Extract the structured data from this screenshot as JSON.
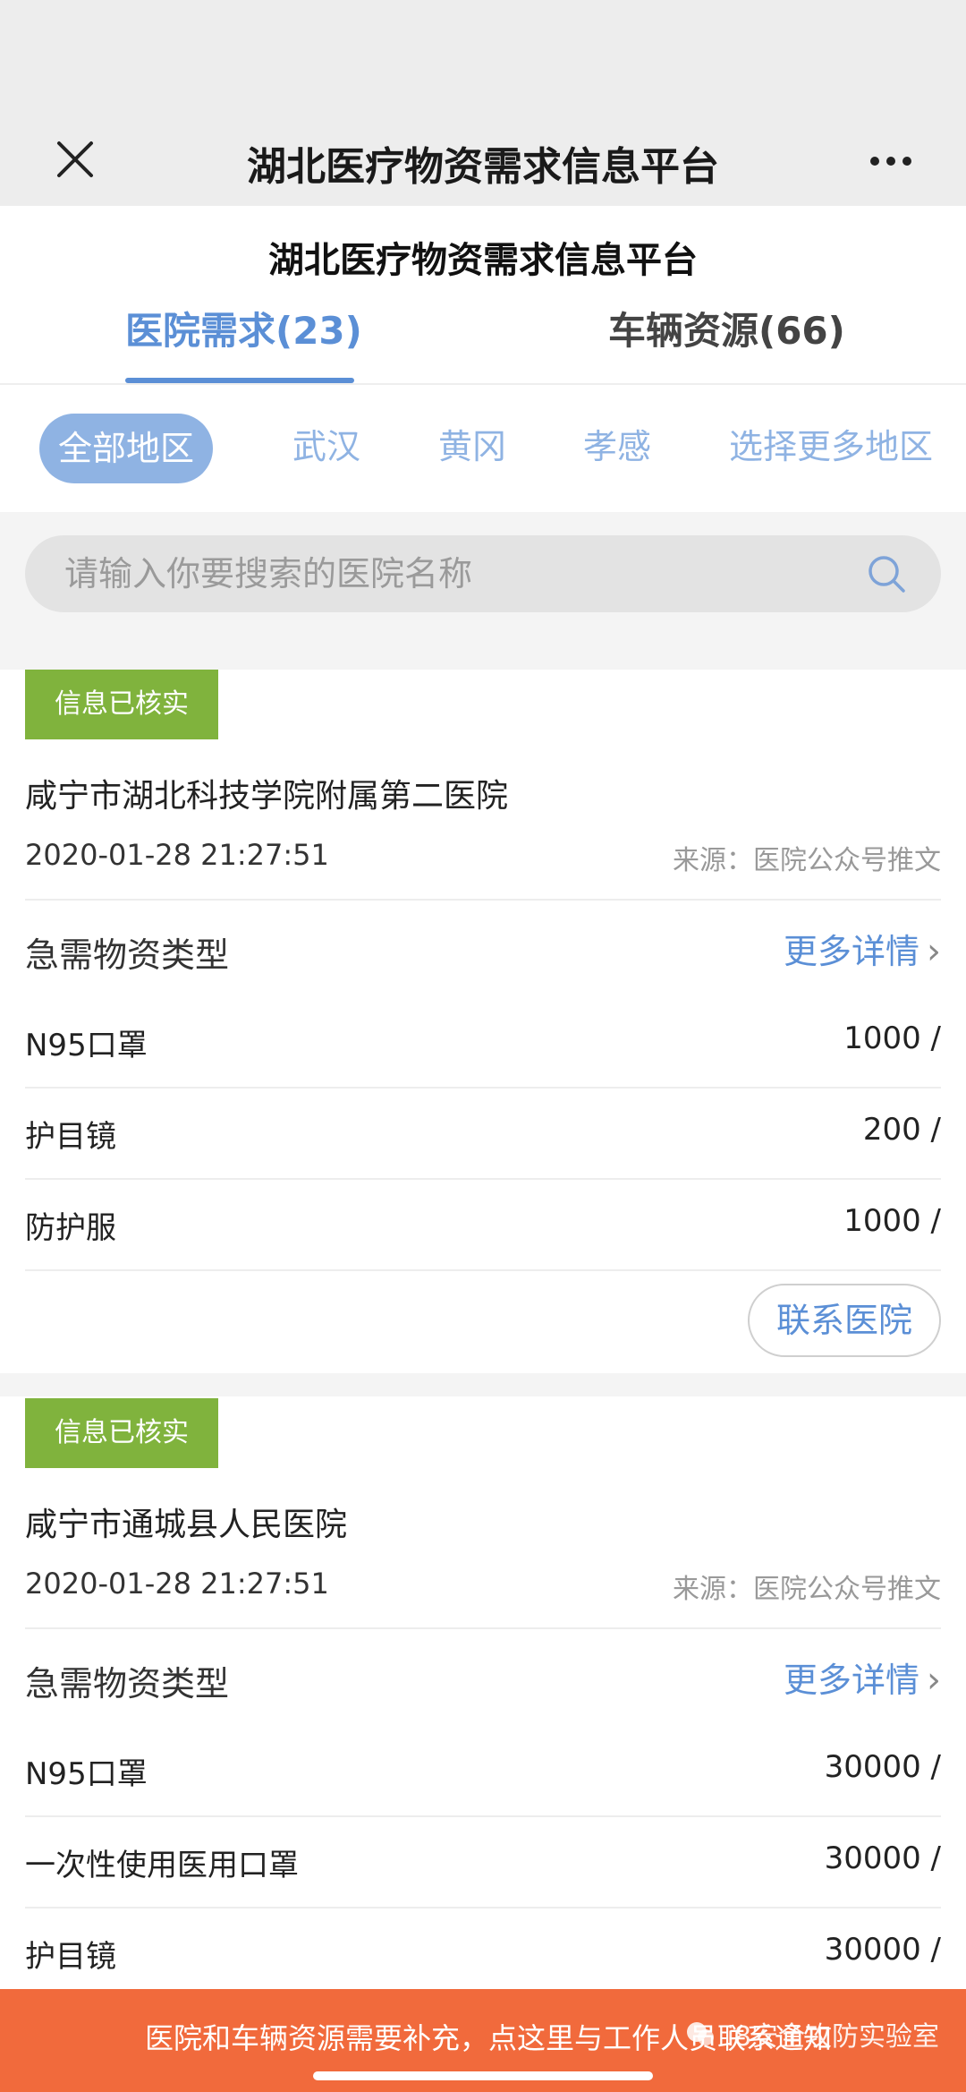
{
  "nav": {
    "title": "湖北医疗物资需求信息平台"
  },
  "page_title": "湖北医疗物资需求信息平台",
  "tabs": [
    {
      "label": "医院需求(23)",
      "active": true
    },
    {
      "label": "车辆资源(66)",
      "active": false
    }
  ],
  "regions": [
    {
      "label": "全部地区",
      "active": true
    },
    {
      "label": "武汉"
    },
    {
      "label": "黄冈"
    },
    {
      "label": "孝感"
    },
    {
      "label": "选择更多地区"
    }
  ],
  "search": {
    "placeholder": "请输入你要搜索的医院名称"
  },
  "cards": [
    {
      "badge": "信息已核实",
      "name": "咸宁市湖北科技学院附属第二医院",
      "date": "2020-01-28 21:27:51",
      "source": "来源：医院公众号推文",
      "type_label": "急需物资类型",
      "more_label": "更多详情",
      "items": [
        {
          "name": "N95口罩",
          "qty": "1000 /"
        },
        {
          "name": "护目镜",
          "qty": "200 /"
        },
        {
          "name": "防护服",
          "qty": "1000 /"
        }
      ],
      "contact_label": "联系医院"
    },
    {
      "badge": "信息已核实",
      "name": "咸宁市通城县人民医院",
      "date": "2020-01-28 21:27:51",
      "source": "来源：医院公众号推文",
      "type_label": "急需物资类型",
      "more_label": "更多详情",
      "items": [
        {
          "name": "N95口罩",
          "qty": "30000 /"
        },
        {
          "name": "一次性使用医用口罩",
          "qty": "30000 /"
        },
        {
          "name": "护目镜",
          "qty": "30000 /"
        }
      ]
    }
  ],
  "footer": {
    "text": "医院和车辆资源需要补充，点这里与工作人员联系通知",
    "watermark": "i8安全攻防实验室"
  },
  "colors": {
    "accent": "#5b8fd6",
    "badge": "#80b33d",
    "banner": "#f16a3c"
  }
}
